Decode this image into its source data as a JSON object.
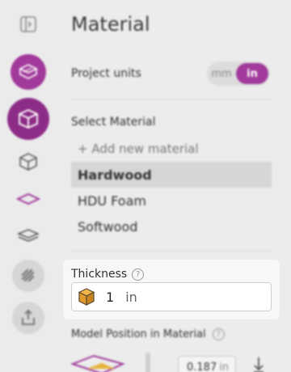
{
  "rail": {
    "items": [
      {
        "name": "sidebar-toggle-icon"
      },
      {
        "name": "material-icon"
      },
      {
        "name": "cube-tool-icon"
      },
      {
        "name": "cube-outline-icon"
      },
      {
        "name": "flat-layer-icon"
      },
      {
        "name": "stack-layer-icon"
      },
      {
        "name": "toolpath-icon"
      },
      {
        "name": "export-icon"
      }
    ]
  },
  "header": {
    "title": "Material"
  },
  "units": {
    "label": "Project units",
    "off": "mm",
    "on": "in"
  },
  "materials": {
    "label": "Select Material",
    "add": "+ Add new material",
    "items": [
      "Hardwood",
      "HDU Foam",
      "Softwood"
    ],
    "selected": "Hardwood"
  },
  "thickness": {
    "label": "Thickness",
    "help": "?",
    "value": "1",
    "unit": "in"
  },
  "position": {
    "label": "Model Position in Material",
    "help": "?",
    "field_value": "0.187",
    "field_unit": "in"
  },
  "colors": {
    "accent": "#a13a9b"
  }
}
